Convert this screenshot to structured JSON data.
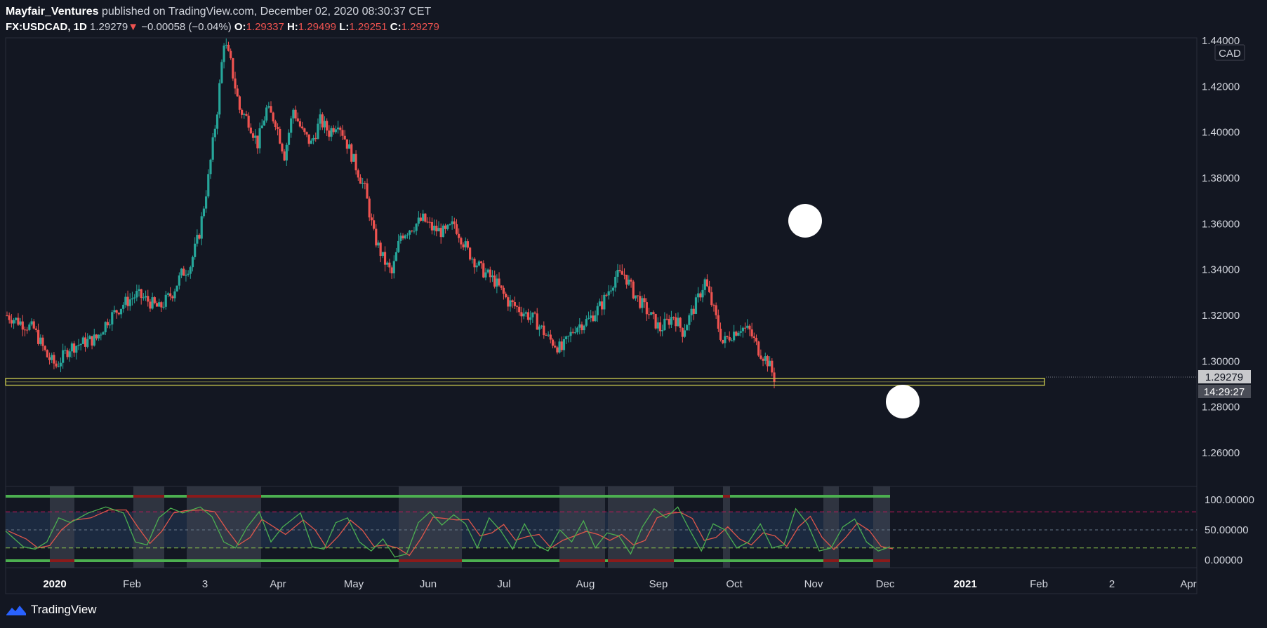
{
  "header": {
    "author": "Mayfair_Ventures",
    "published": " published on TradingView.com, December 02, 2020 08:30:37 CET",
    "symbol": "FX:USDCAD, 1D",
    "last": "1.29279",
    "change": "−0.00058 (−0.04%)",
    "open_label": "O:",
    "open": "1.29337",
    "high_label": "H:",
    "high": "1.29499",
    "low_label": "L:",
    "low": "1.29251",
    "close_label": "C:",
    "close": "1.29279"
  },
  "price_axis": {
    "currency": "CAD",
    "ticks": [
      "1.44000",
      "1.42000",
      "1.40000",
      "1.38000",
      "1.36000",
      "1.34000",
      "1.32000",
      "1.30000",
      "1.28000",
      "1.26000"
    ],
    "last_price_label": "1.29279",
    "countdown": "14:29:27"
  },
  "indicator_axis": {
    "ticks": [
      "100.00000",
      "50.00000",
      "0.00000"
    ]
  },
  "time_axis": {
    "labels": [
      "2020",
      "Feb",
      "3",
      "Apr",
      "May",
      "Jun",
      "Jul",
      "Aug",
      "Sep",
      "Oct",
      "Nov",
      "Dec",
      "2021",
      "Feb",
      "2",
      "Apr"
    ],
    "bold": [
      "2020",
      "2021"
    ]
  },
  "footer": {
    "brand": "TradingView"
  },
  "colors": {
    "background": "#131722",
    "up": "#26a69a",
    "down": "#ef5350",
    "support_zone": "#b8b84a",
    "stoch_k": "#4caf50",
    "stoch_d": "#e0564a"
  },
  "chart_data": {
    "type": "candlestick",
    "symbol": "USDCAD",
    "interval": "1D",
    "y_range": [
      1.245,
      1.445
    ],
    "candle_count": 235,
    "support_zone": [
      1.2895,
      1.2925
    ],
    "close_path": [
      [
        0,
        1.32
      ],
      [
        12,
        1.314
      ],
      [
        18,
        1.302
      ],
      [
        22,
        1.298
      ],
      [
        28,
        1.306
      ],
      [
        40,
        1.31
      ],
      [
        45,
        1.318
      ],
      [
        52,
        1.325
      ],
      [
        58,
        1.329
      ],
      [
        62,
        1.327
      ],
      [
        68,
        1.323
      ],
      [
        74,
        1.33
      ],
      [
        78,
        1.338
      ],
      [
        82,
        1.342
      ],
      [
        86,
        1.356
      ],
      [
        90,
        1.38
      ],
      [
        94,
        1.41
      ],
      [
        97,
        1.44
      ],
      [
        100,
        1.43
      ],
      [
        104,
        1.41
      ],
      [
        108,
        1.405
      ],
      [
        112,
        1.395
      ],
      [
        116,
        1.41
      ],
      [
        120,
        1.405
      ],
      [
        124,
        1.39
      ],
      [
        128,
        1.41
      ],
      [
        132,
        1.4
      ],
      [
        136,
        1.395
      ],
      [
        140,
        1.405
      ],
      [
        144,
        1.4
      ],
      [
        148,
        1.405
      ],
      [
        152,
        1.395
      ],
      [
        156,
        1.385
      ],
      [
        160,
        1.375
      ],
      [
        164,
        1.355
      ],
      [
        168,
        1.345
      ],
      [
        172,
        1.338
      ],
      [
        176,
        1.355
      ],
      [
        180,
        1.358
      ],
      [
        186,
        1.362
      ],
      [
        190,
        1.358
      ],
      [
        196,
        1.356
      ],
      [
        200,
        1.36
      ],
      [
        206,
        1.348
      ],
      [
        212,
        1.34
      ],
      [
        218,
        1.335
      ],
      [
        224,
        1.326
      ],
      [
        230,
        1.322
      ]
    ],
    "close_path_note": "continuation",
    "close_path_tail": [
      [
        230,
        1.322
      ],
      [
        236,
        1.318
      ],
      [
        242,
        1.31
      ],
      [
        248,
        1.305
      ],
      [
        254,
        1.315
      ],
      [
        260,
        1.318
      ],
      [
        266,
        1.325
      ],
      [
        272,
        1.337
      ],
      [
        276,
        1.338
      ],
      [
        280,
        1.33
      ],
      [
        286,
        1.322
      ],
      [
        292,
        1.314
      ],
      [
        298,
        1.32
      ],
      [
        302,
        1.313
      ],
      [
        308,
        1.325
      ],
      [
        312,
        1.335
      ],
      [
        316,
        1.322
      ],
      [
        320,
        1.308
      ],
      [
        324,
        1.312
      ],
      [
        328,
        1.315
      ],
      [
        332,
        1.313
      ],
      [
        336,
        1.305
      ],
      [
        340,
        1.3
      ],
      [
        343,
        1.2928
      ]
    ],
    "stochastic": {
      "levels": {
        "upper": 80,
        "middle": 50,
        "lower": 20
      },
      "y_range": [
        0,
        100
      ],
      "k_path": [
        [
          0,
          48
        ],
        [
          6,
          22
        ],
        [
          10,
          18
        ],
        [
          14,
          30
        ],
        [
          18,
          70
        ],
        [
          22,
          62
        ],
        [
          28,
          78
        ],
        [
          34,
          88
        ],
        [
          40,
          78
        ],
        [
          44,
          30
        ],
        [
          48,
          25
        ],
        [
          52,
          70
        ],
        [
          56,
          86
        ],
        [
          60,
          78
        ],
        [
          66,
          88
        ],
        [
          70,
          72
        ],
        [
          74,
          30
        ],
        [
          78,
          20
        ],
        [
          82,
          55
        ],
        [
          86,
          80
        ],
        [
          90,
          30
        ],
        [
          94,
          55
        ],
        [
          100,
          78
        ],
        [
          104,
          22
        ],
        [
          108,
          18
        ],
        [
          112,
          62
        ],
        [
          116,
          70
        ],
        [
          120,
          30
        ],
        [
          124,
          15
        ],
        [
          128,
          35
        ],
        [
          132,
          5
        ],
        [
          136,
          10
        ],
        [
          140,
          62
        ],
        [
          144,
          80
        ],
        [
          148,
          58
        ],
        [
          152,
          75
        ],
        [
          156,
          60
        ],
        [
          160,
          20
        ],
        [
          164,
          70
        ],
        [
          168,
          48
        ],
        [
          172,
          18
        ],
        [
          176,
          60
        ],
        [
          180,
          25
        ],
        [
          184,
          15
        ],
        [
          188,
          50
        ],
        [
          192,
          30
        ],
        [
          196,
          65
        ],
        [
          200,
          20
        ],
        [
          204,
          45
        ],
        [
          208,
          40
        ],
        [
          212,
          10
        ],
        [
          216,
          55
        ],
        [
          220,
          85
        ],
        [
          224,
          70
        ],
        [
          228,
          88
        ],
        [
          232,
          50
        ],
        [
          236,
          15
        ],
        [
          240,
          60
        ],
        [
          244,
          50
        ],
        [
          248,
          20
        ],
        [
          252,
          30
        ],
        [
          256,
          60
        ],
        [
          260,
          20
        ],
        [
          264,
          25
        ],
        [
          268,
          85
        ],
        [
          272,
          60
        ],
        [
          276,
          15
        ],
        [
          280,
          20
        ],
        [
          284,
          55
        ],
        [
          288,
          68
        ],
        [
          292,
          30
        ],
        [
          296,
          15
        ],
        [
          300,
          22
        ]
      ]
    }
  }
}
